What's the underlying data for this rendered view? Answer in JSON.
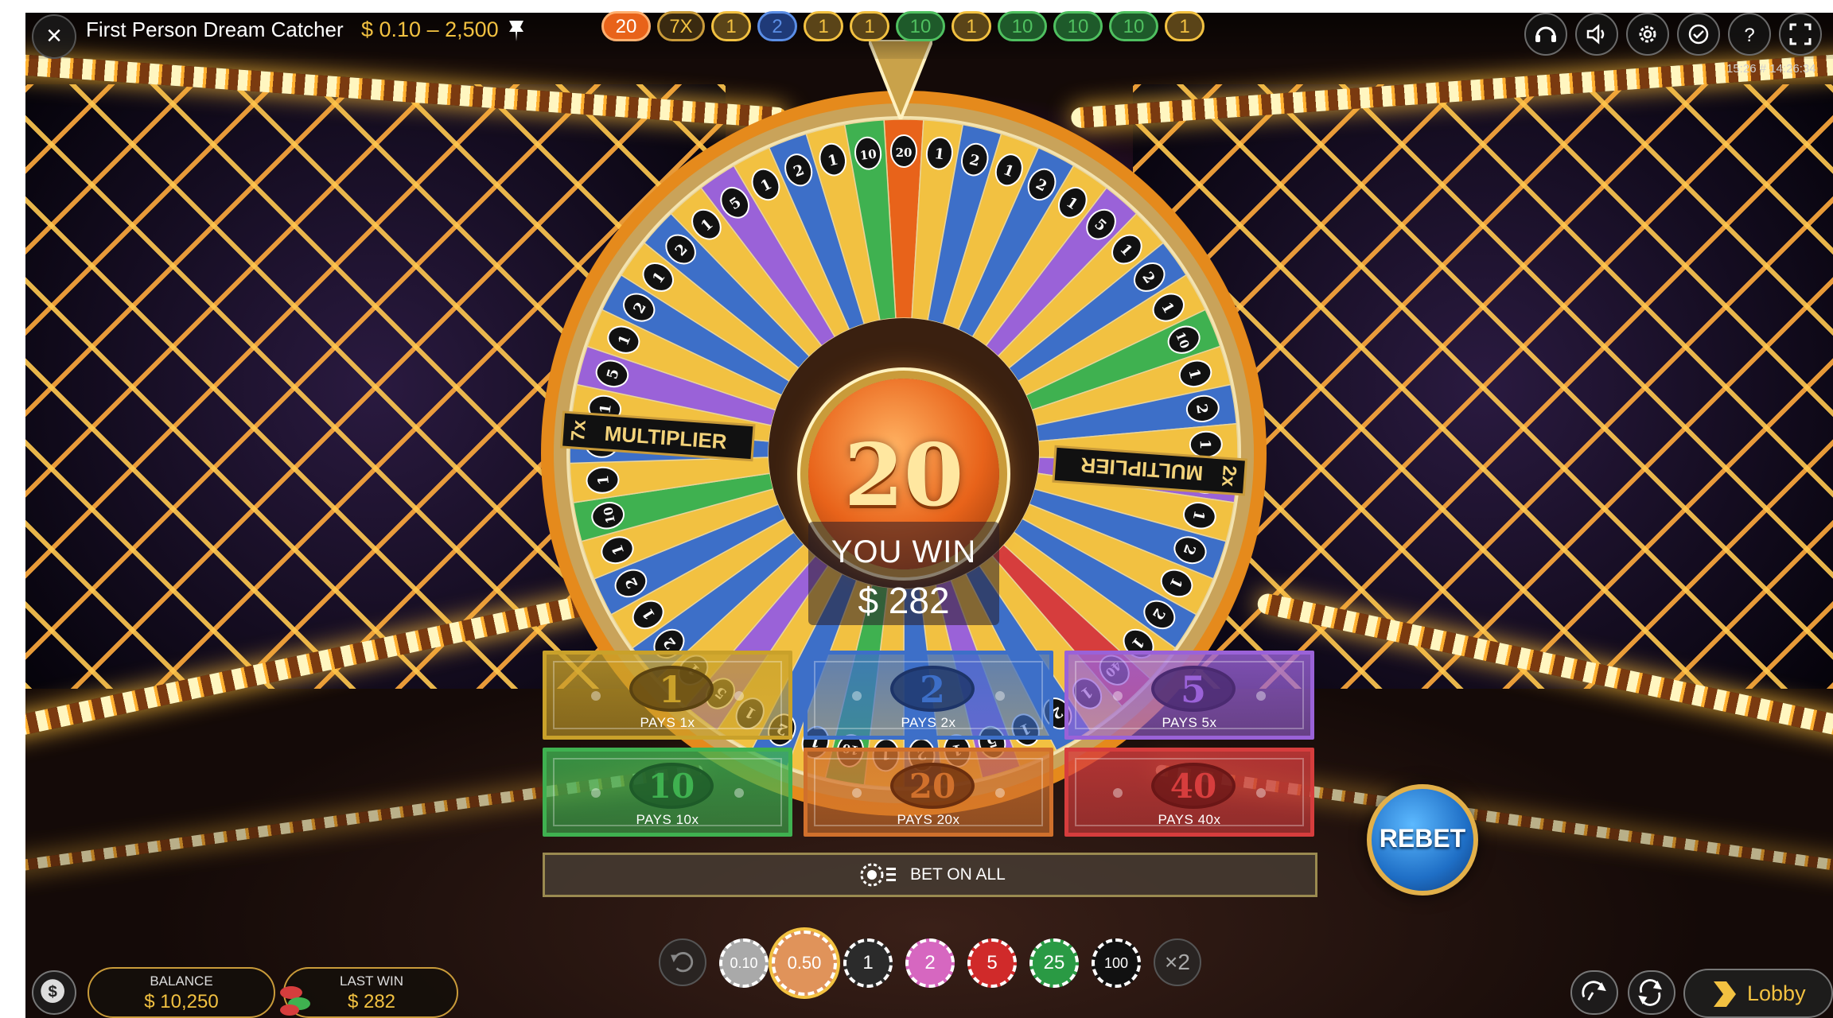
{
  "header": {
    "title": "First Person Dream Catcher",
    "bet_limits": "$ 0.10 – 2,500",
    "timestamp": "15:26 # 14:26:34"
  },
  "history": [
    "20",
    "7X",
    "1",
    "2",
    "1",
    "1",
    "10",
    "1",
    "10",
    "10",
    "10",
    "1"
  ],
  "wheel": {
    "result": "20",
    "left_multiplier_text": "MULTIPLIER",
    "left_multiplier_value": "7x",
    "right_multiplier_text": "MULTIPLIER",
    "right_multiplier_value": "2x"
  },
  "win": {
    "label": "YOU WIN",
    "amount": "$ 282"
  },
  "bets": [
    {
      "number": "1",
      "pays": "PAYS 1x",
      "color": "#c9a12a"
    },
    {
      "number": "2",
      "pays": "PAYS 2x",
      "color": "#3d6fc8"
    },
    {
      "number": "5",
      "pays": "PAYS 5x",
      "color": "#9a62d8"
    },
    {
      "number": "10",
      "pays": "PAYS 10x",
      "color": "#3fb150"
    },
    {
      "number": "20",
      "pays": "PAYS 20x",
      "color": "#d0702c"
    },
    {
      "number": "40",
      "pays": "PAYS 40x",
      "color": "#d63d3d"
    }
  ],
  "bet_on_all": "BET ON ALL",
  "rebet": "REBET",
  "chips": [
    "0.10",
    "0.50",
    "1",
    "2",
    "5",
    "25",
    "100"
  ],
  "selected_chip": "0.50",
  "double": "×2",
  "balance": {
    "label": "BALANCE",
    "value": "$ 10,250"
  },
  "last_win": {
    "label": "LAST WIN",
    "value": "$ 282"
  },
  "lobby": "Lobby",
  "colors": {
    "accent": "#f2c141",
    "one": "#f2c141",
    "two": "#3d6fc8",
    "five": "#9a62d8",
    "ten": "#3fb150",
    "twenty": "#e8631a",
    "forty": "#d63d3d"
  },
  "icons": [
    "close-icon",
    "pin-icon",
    "headset-icon",
    "sound-icon",
    "gear-icon",
    "history-icon",
    "help-icon",
    "fullscreen-icon",
    "dollar-icon",
    "undo-icon",
    "chip-stack-icon",
    "game-switch-icon",
    "autoplay-icon",
    "lobby-arrow-icon"
  ]
}
